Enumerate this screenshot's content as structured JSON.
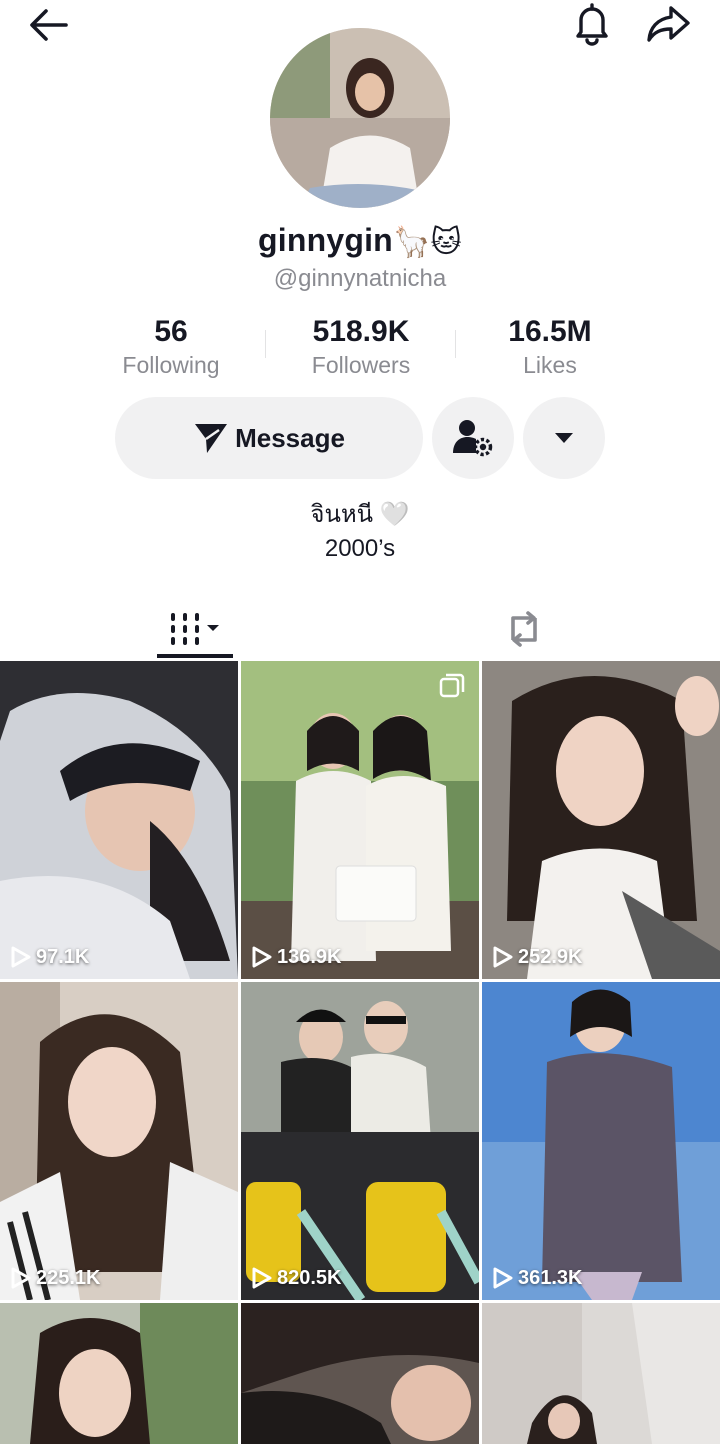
{
  "profile": {
    "username": "ginnygin",
    "emojis": "🦙🐱",
    "handle": "@ginnynatnicha",
    "bio_line1": "จินหนี 🤍",
    "bio_line2": "2000’s"
  },
  "stats": [
    {
      "value": "56",
      "label": "Following"
    },
    {
      "value": "518.9K",
      "label": "Followers"
    },
    {
      "value": "16.5M",
      "label": "Likes"
    }
  ],
  "actions": {
    "message_label": "Message"
  },
  "icons": {
    "back": "arrow-left-icon",
    "bell": "bell-icon",
    "share": "share-arrow-icon",
    "message": "paper-plane-icon",
    "follow_settings": "user-gear-icon",
    "more": "caret-down-icon",
    "videos_tab": "grid-bars-icon",
    "reposts_tab": "repost-icon",
    "play": "play-icon"
  },
  "videos": [
    {
      "views": "97.1K"
    },
    {
      "views": "136.9K"
    },
    {
      "views": "252.9K"
    },
    {
      "views": "225.1K"
    },
    {
      "views": "820.5K"
    },
    {
      "views": "361.3K"
    },
    {
      "views": ""
    },
    {
      "views": ""
    },
    {
      "views": ""
    }
  ]
}
